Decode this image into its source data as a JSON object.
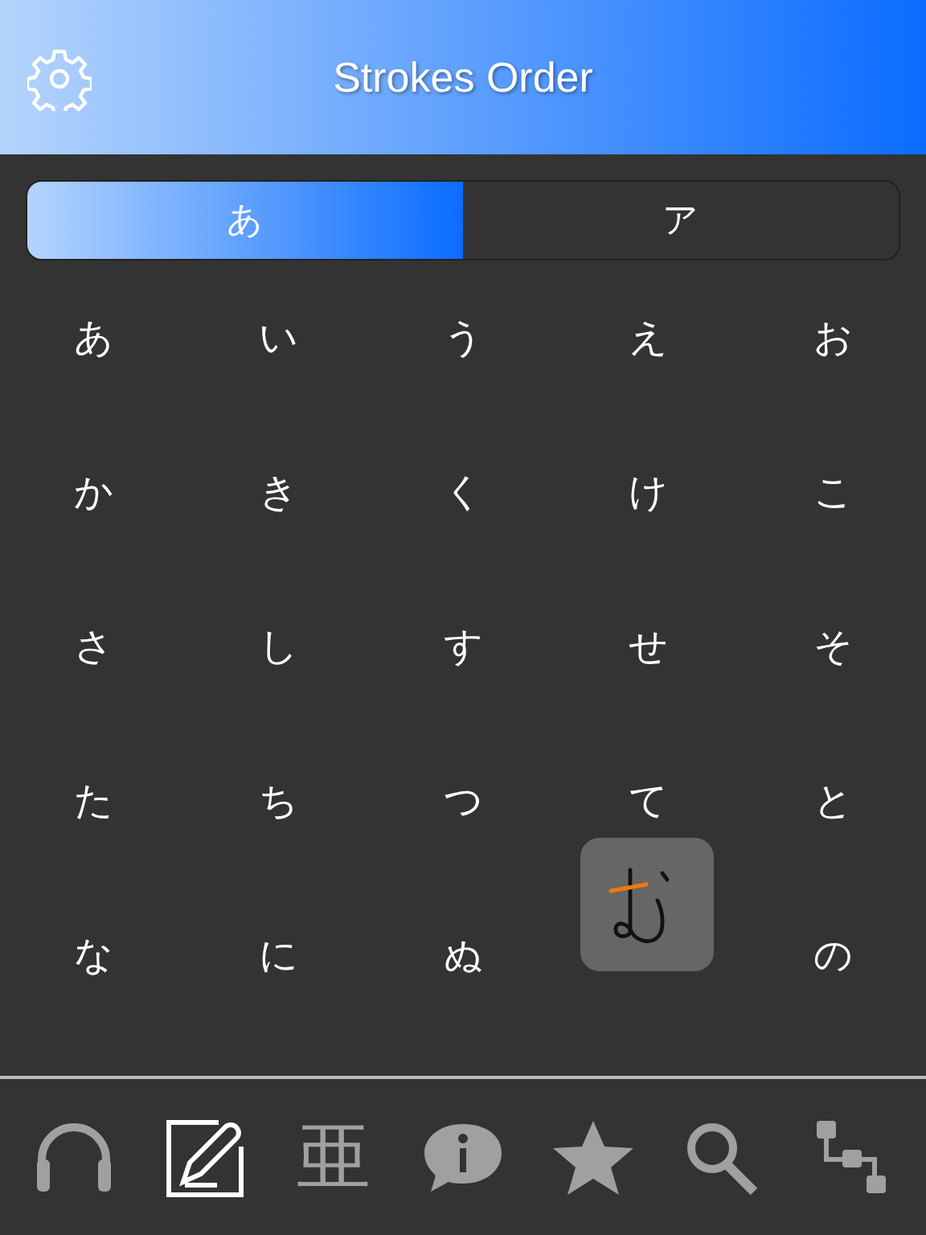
{
  "header": {
    "title": "Strokes Order"
  },
  "segments": [
    {
      "label": "あ",
      "selected": true
    },
    {
      "label": "ア",
      "selected": false
    }
  ],
  "grid": [
    {
      "kind": "kana",
      "text": "あ"
    },
    {
      "kind": "kana",
      "text": "い"
    },
    {
      "kind": "kana",
      "text": "う"
    },
    {
      "kind": "kana",
      "text": "え"
    },
    {
      "kind": "kana",
      "text": "お"
    },
    {
      "kind": "kana",
      "text": "か"
    },
    {
      "kind": "kana",
      "text": "き"
    },
    {
      "kind": "kana",
      "text": "く"
    },
    {
      "kind": "kana",
      "text": "け"
    },
    {
      "kind": "kana",
      "text": "こ"
    },
    {
      "kind": "kana",
      "text": "さ"
    },
    {
      "kind": "kana",
      "text": "し"
    },
    {
      "kind": "kana",
      "text": "す"
    },
    {
      "kind": "kana",
      "text": "せ"
    },
    {
      "kind": "kana",
      "text": "そ"
    },
    {
      "kind": "kana",
      "text": "た"
    },
    {
      "kind": "kana",
      "text": "ち"
    },
    {
      "kind": "kana",
      "text": "つ"
    },
    {
      "kind": "kana",
      "text": "て"
    },
    {
      "kind": "kana",
      "text": "と"
    },
    {
      "kind": "kana",
      "text": "な"
    },
    {
      "kind": "kana",
      "text": "に"
    },
    {
      "kind": "kana",
      "text": "ぬ"
    },
    {
      "kind": "popup"
    },
    {
      "kind": "kana",
      "text": "の"
    }
  ],
  "tab_bar": [
    {
      "selected": false
    },
    {
      "selected": true
    },
    {
      "label": "亜",
      "selected": false
    },
    {
      "selected": false
    },
    {
      "selected": false
    },
    {
      "selected": false
    },
    {
      "selected": false
    }
  ]
}
